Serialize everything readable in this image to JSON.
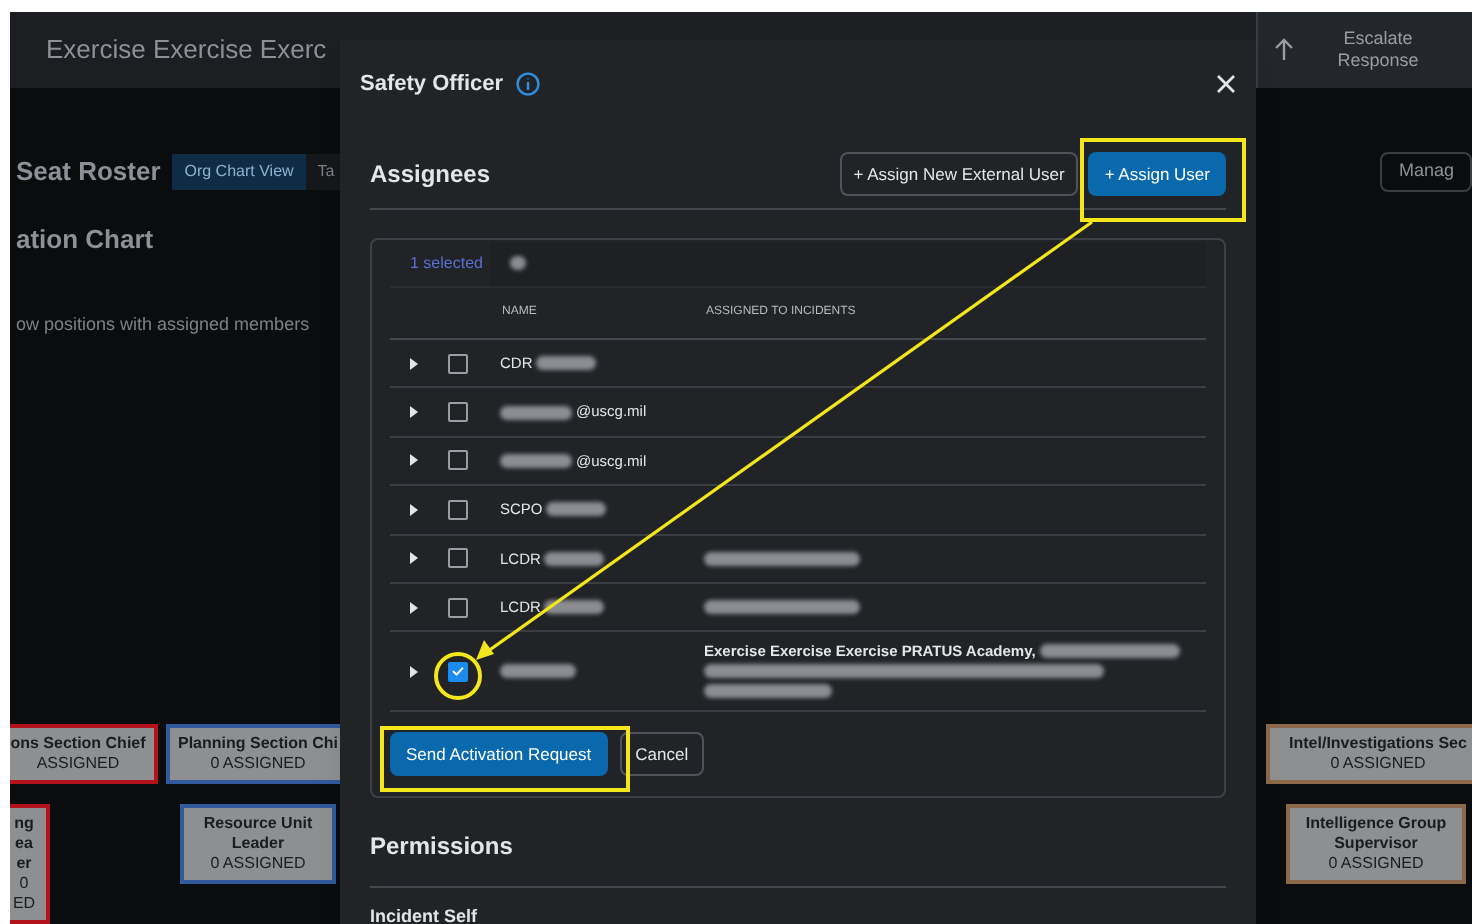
{
  "app_header": {
    "title": "Exercise Exercise Exerc",
    "escalate_button": "Escalate Response"
  },
  "roster": {
    "title": "Seat Roster",
    "tabs": [
      {
        "label": "Org Chart View",
        "selected": true
      },
      {
        "label": "Ta",
        "selected": false
      }
    ],
    "manage_button": "Manag",
    "section_title": "ation Chart",
    "filter_text": "ow positions with assigned members"
  },
  "org_chart": {
    "nodes": [
      {
        "title": "ons Section Chief",
        "count": "ASSIGNED",
        "color": "#b3121b"
      },
      {
        "title": "Planning Section Chi",
        "count": "0 ASSIGNED",
        "color": "#2f5a9e"
      },
      {
        "title": "Intel/Investigations Sec",
        "count": "0 ASSIGNED",
        "color": "#8a6a4a"
      },
      {
        "title": "ng ea er",
        "count": "0 ED",
        "color": "#b3121b"
      },
      {
        "title": "Resource Unit Leader",
        "count": "0 ASSIGNED",
        "color": "#2f5a9e"
      },
      {
        "title": "Intelligence Group Supervisor",
        "count": "0 ASSIGNED",
        "color": "#8a6a4a"
      }
    ]
  },
  "dialog": {
    "title": "Safety Officer",
    "assignees_heading": "Assignees",
    "assign_external_button": "+ Assign New External User",
    "assign_user_button": "+ Assign User",
    "selection_count": "1 selected",
    "columns": [
      "NAME",
      "ASSIGNED TO INCIDENTS"
    ],
    "rows": [
      {
        "kind": "rank",
        "name": "CDR",
        "incidents": "",
        "incidents_redacted": false,
        "checked": false
      },
      {
        "kind": "email",
        "name": "@uscg.mil",
        "incidents": "",
        "incidents_redacted": false,
        "checked": false
      },
      {
        "kind": "email",
        "name": "@uscg.mil",
        "incidents": "",
        "incidents_redacted": false,
        "checked": false
      },
      {
        "kind": "rank",
        "name": "SCPO",
        "incidents": "",
        "incidents_redacted": false,
        "checked": false
      },
      {
        "kind": "rank",
        "name": "LCDR",
        "incidents": "",
        "incidents_redacted": true,
        "checked": false
      },
      {
        "kind": "rank",
        "name": "LCDR",
        "incidents": "",
        "incidents_redacted": true,
        "checked": false
      },
      {
        "kind": "hidden",
        "name": "",
        "incidents": "Exercise Exercise Exercise PRATUS Academy,",
        "incidents_redacted": true,
        "checked": true
      }
    ],
    "send_button": "Send Activation Request",
    "cancel_button": "Cancel",
    "permissions_heading": "Permissions",
    "permissions_item": "Incident Self"
  }
}
